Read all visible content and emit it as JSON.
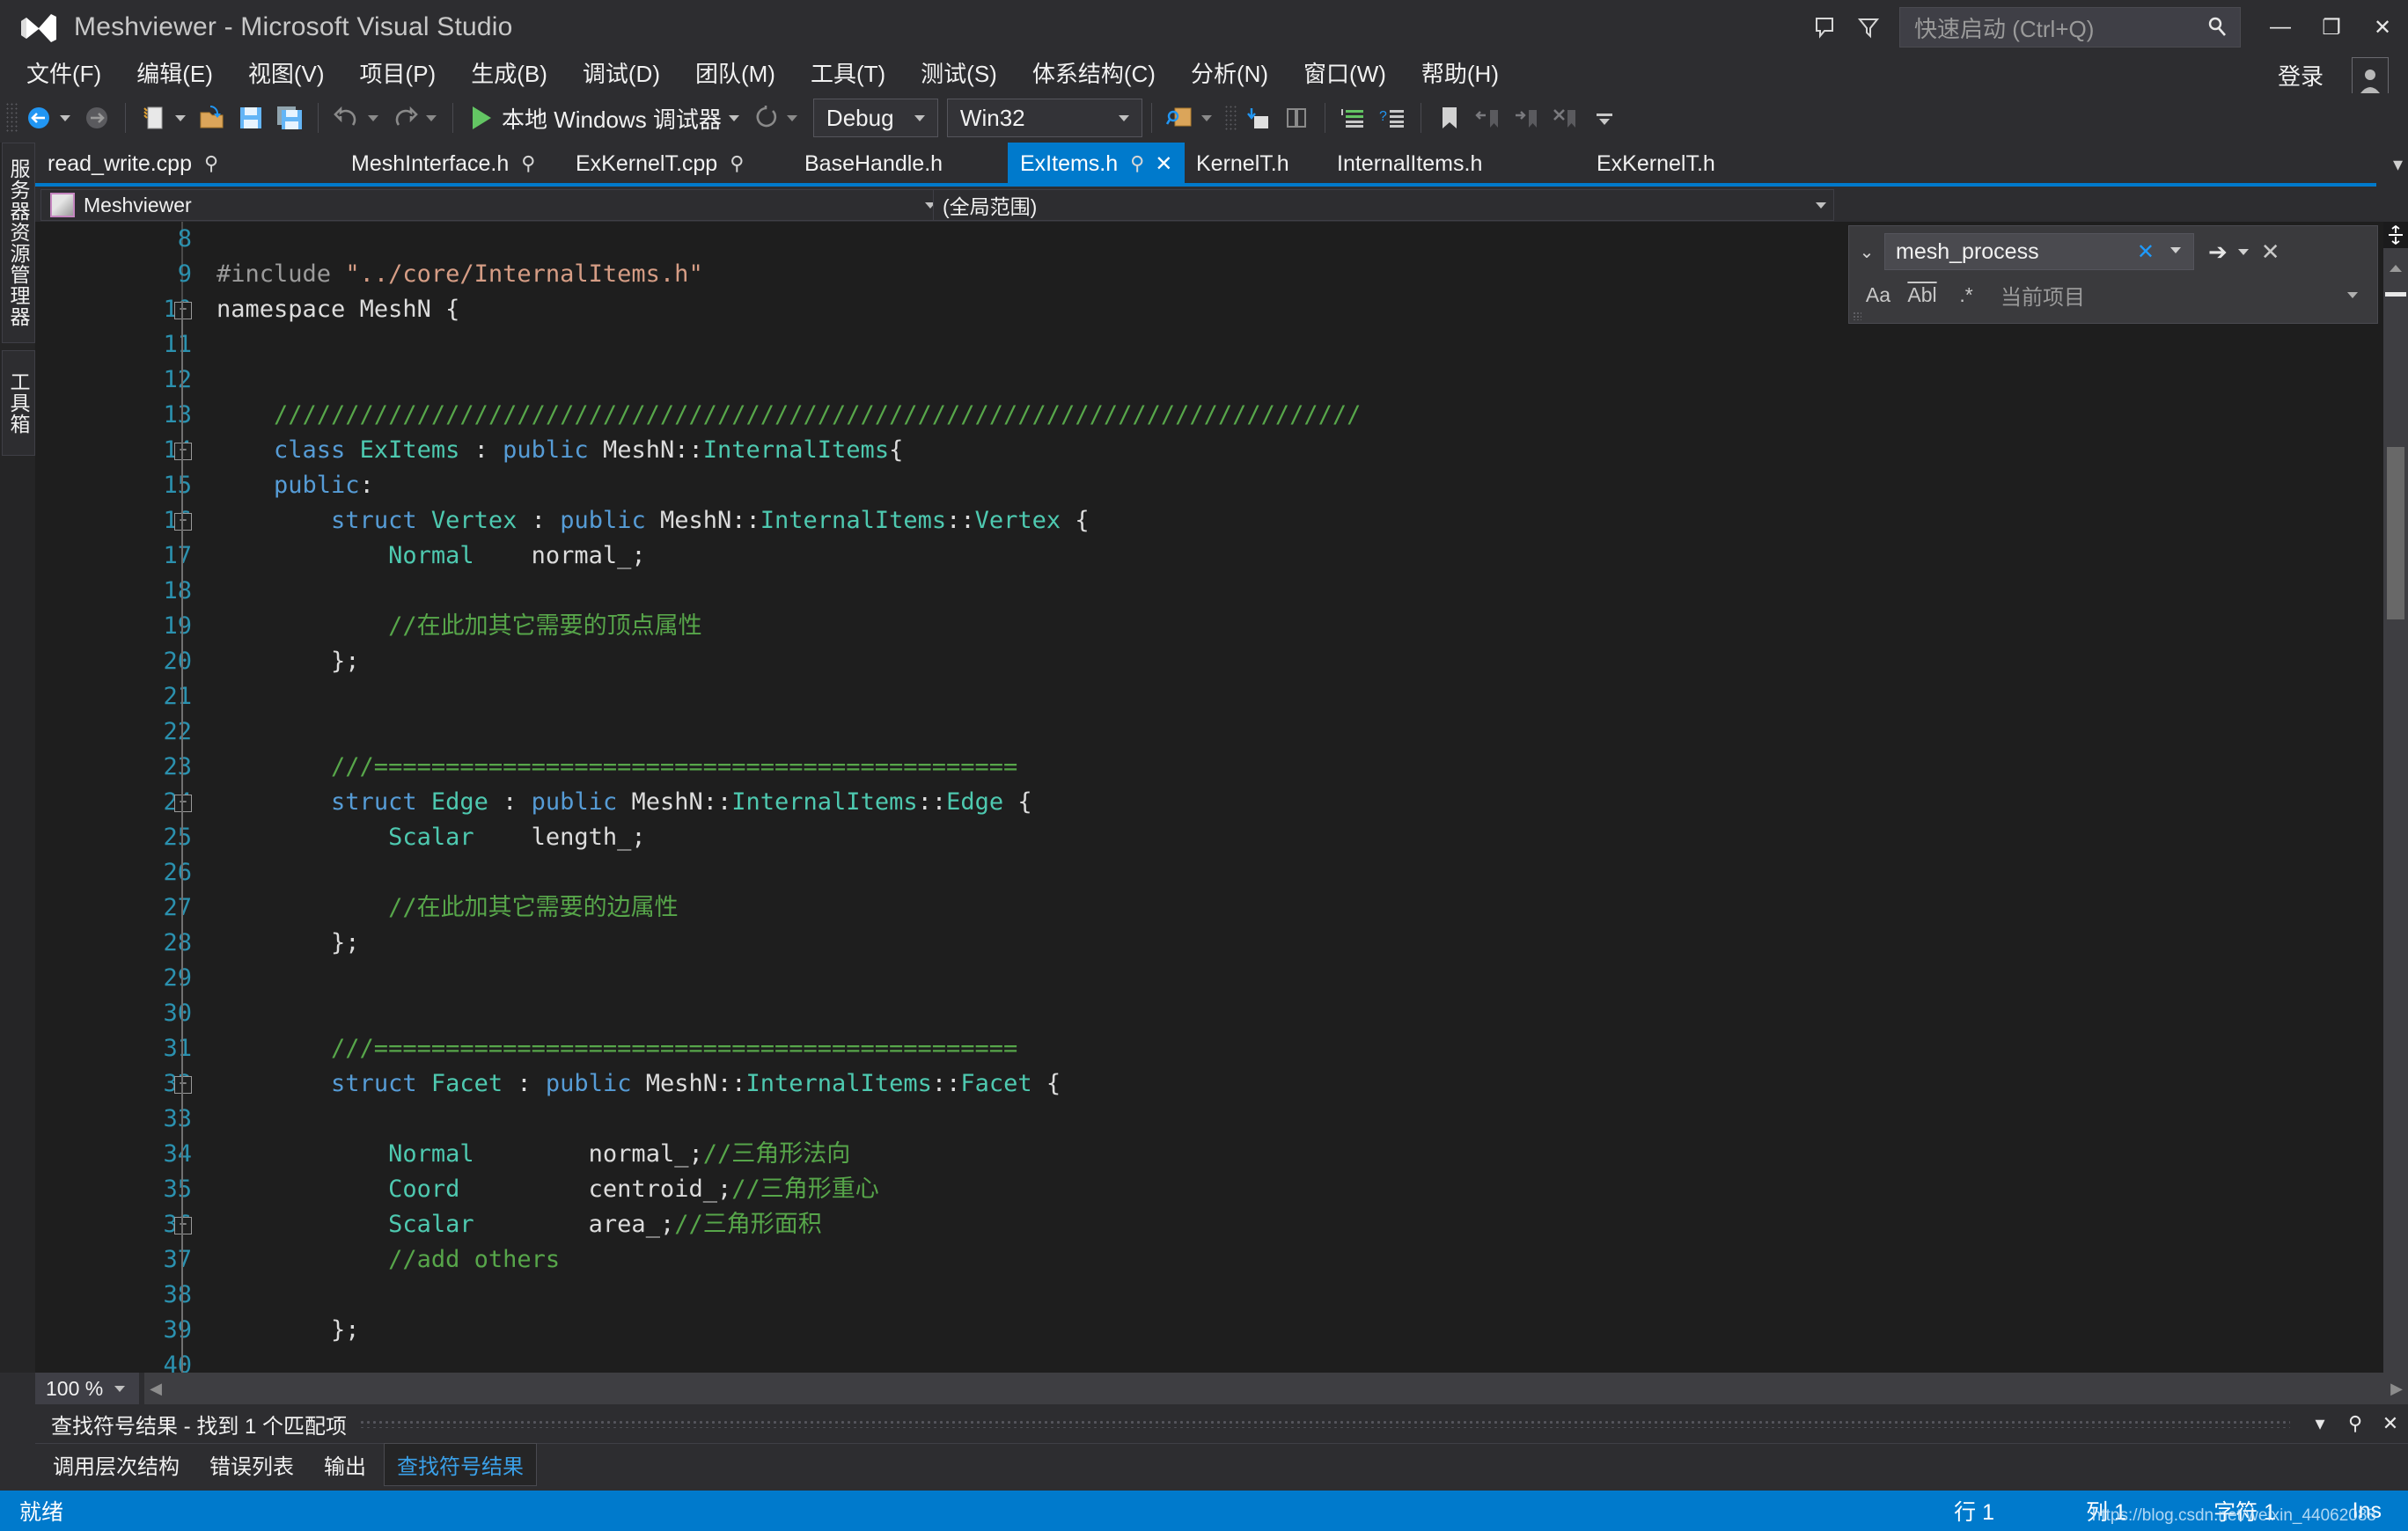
{
  "titlebar": {
    "title": "Meshviewer - Microsoft Visual Studio",
    "quick_launch_placeholder": "快速启动 (Ctrl+Q)",
    "feedback_icon": "feedback-icon",
    "filter_icon": "filter-icon",
    "search_icon": "search-icon",
    "minimize": "—",
    "restore": "❐",
    "close": "✕",
    "signin": "登录"
  },
  "menubar": {
    "items": [
      {
        "label": "文件(F)"
      },
      {
        "label": "编辑(E)"
      },
      {
        "label": "视图(V)"
      },
      {
        "label": "项目(P)"
      },
      {
        "label": "生成(B)"
      },
      {
        "label": "调试(D)"
      },
      {
        "label": "团队(M)"
      },
      {
        "label": "工具(T)"
      },
      {
        "label": "测试(S)"
      },
      {
        "label": "体系结构(C)"
      },
      {
        "label": "分析(N)"
      },
      {
        "label": "窗口(W)"
      },
      {
        "label": "帮助(H)"
      }
    ]
  },
  "toolbar": {
    "run_label": "本地 Windows 调试器",
    "config": "Debug",
    "platform": "Win32",
    "icons": {
      "nav_back": "navigate-back-icon",
      "nav_forward": "navigate-forward-icon",
      "new_project": "new-project-icon",
      "open_file": "open-file-icon",
      "save": "save-icon",
      "save_all": "save-all-icon",
      "undo": "undo-icon",
      "redo": "redo-icon",
      "restart": "restart-icon",
      "find_in_files": "find-in-files-icon",
      "step_into": "step-into-icon",
      "step_over": "step-over-icon",
      "comment": "comment-lines-icon",
      "uncomment": "uncomment-lines-icon",
      "bookmark": "bookmark-icon",
      "prev_bookmark": "previous-bookmark-icon",
      "next_bookmark": "next-bookmark-icon",
      "clear_bookmarks": "clear-bookmarks-icon",
      "overflow": "toolbar-overflow-icon"
    }
  },
  "leftdock": {
    "tabs": [
      {
        "label": "服务器资源管理器"
      },
      {
        "label": "工具箱"
      }
    ]
  },
  "tabs": [
    {
      "label": "read_write.cpp",
      "pinned": true,
      "active": false
    },
    {
      "label": "MeshInterface.h",
      "pinned": true,
      "active": false
    },
    {
      "label": "ExKernelT.cpp",
      "pinned": true,
      "active": false
    },
    {
      "label": "BaseHandle.h",
      "pinned": false,
      "active": false
    },
    {
      "label": "ExItems.h",
      "pinned": true,
      "active": true
    },
    {
      "label": "KernelT.h",
      "pinned": false,
      "active": false
    },
    {
      "label": "InternalItems.h",
      "pinned": false,
      "active": false
    },
    {
      "label": "ExKernelT.h",
      "pinned": false,
      "active": false
    }
  ],
  "navbar": {
    "project": "Meshviewer",
    "scope": "(全局范围)"
  },
  "find": {
    "query": "mesh_process",
    "scope": "当前项目",
    "match_case": "Aa",
    "match_word": "Abl",
    "regex": ".*",
    "clear": "✕",
    "find_next": "➔",
    "close": "✕"
  },
  "editor": {
    "first_line": 8,
    "zoom": "100 %",
    "lines": [
      {
        "n": 8,
        "fold": "",
        "tokens": []
      },
      {
        "n": 9,
        "fold": "",
        "tokens": [
          {
            "t": "#include ",
            "c": "pp"
          },
          {
            "t": "\"../core/InternalItems.h\"",
            "c": "str"
          }
        ]
      },
      {
        "n": 10,
        "fold": "minus",
        "tokens": [
          {
            "t": "namespace",
            "c": "txt"
          },
          {
            "t": " MeshN {",
            "c": "txt"
          }
        ]
      },
      {
        "n": 11,
        "fold": "",
        "tokens": []
      },
      {
        "n": 12,
        "fold": "",
        "tokens": []
      },
      {
        "n": 13,
        "fold": "",
        "tokens": [
          {
            "t": "    ////////////////////////////////////////////////////////////////////////////",
            "c": "cmt"
          }
        ]
      },
      {
        "n": 14,
        "fold": "minus",
        "tokens": [
          {
            "t": "    ",
            "c": "txt"
          },
          {
            "t": "class",
            "c": "kw"
          },
          {
            "t": " ",
            "c": "txt"
          },
          {
            "t": "ExItems",
            "c": "type"
          },
          {
            "t": " : ",
            "c": "txt"
          },
          {
            "t": "public",
            "c": "kw"
          },
          {
            "t": " MeshN::",
            "c": "txt"
          },
          {
            "t": "InternalItems",
            "c": "type"
          },
          {
            "t": "{",
            "c": "txt"
          }
        ]
      },
      {
        "n": 15,
        "fold": "",
        "tokens": [
          {
            "t": "    ",
            "c": "txt"
          },
          {
            "t": "public",
            "c": "kw"
          },
          {
            "t": ":",
            "c": "txt"
          }
        ]
      },
      {
        "n": 16,
        "fold": "minus",
        "tokens": [
          {
            "t": "        ",
            "c": "txt"
          },
          {
            "t": "struct",
            "c": "kw"
          },
          {
            "t": " ",
            "c": "txt"
          },
          {
            "t": "Vertex",
            "c": "type"
          },
          {
            "t": " : ",
            "c": "txt"
          },
          {
            "t": "public",
            "c": "kw"
          },
          {
            "t": " MeshN::",
            "c": "txt"
          },
          {
            "t": "InternalItems",
            "c": "type"
          },
          {
            "t": "::",
            "c": "txt"
          },
          {
            "t": "Vertex",
            "c": "type"
          },
          {
            "t": " {",
            "c": "txt"
          }
        ]
      },
      {
        "n": 17,
        "fold": "",
        "tokens": [
          {
            "t": "            ",
            "c": "txt"
          },
          {
            "t": "Normal",
            "c": "type"
          },
          {
            "t": "    normal_;",
            "c": "txt"
          }
        ]
      },
      {
        "n": 18,
        "fold": "",
        "tokens": []
      },
      {
        "n": 19,
        "fold": "",
        "tokens": [
          {
            "t": "            //在此加其它需要的顶点属性",
            "c": "cmt"
          }
        ]
      },
      {
        "n": 20,
        "fold": "",
        "tokens": [
          {
            "t": "        };",
            "c": "txt"
          }
        ]
      },
      {
        "n": 21,
        "fold": "",
        "tokens": []
      },
      {
        "n": 22,
        "fold": "",
        "tokens": []
      },
      {
        "n": 23,
        "fold": "",
        "tokens": [
          {
            "t": "        ///=============================================",
            "c": "cmt"
          }
        ]
      },
      {
        "n": 24,
        "fold": "minus",
        "tokens": [
          {
            "t": "        ",
            "c": "txt"
          },
          {
            "t": "struct",
            "c": "kw"
          },
          {
            "t": " ",
            "c": "txt"
          },
          {
            "t": "Edge",
            "c": "type"
          },
          {
            "t": " : ",
            "c": "txt"
          },
          {
            "t": "public",
            "c": "kw"
          },
          {
            "t": " MeshN::",
            "c": "txt"
          },
          {
            "t": "InternalItems",
            "c": "type"
          },
          {
            "t": "::",
            "c": "txt"
          },
          {
            "t": "Edge",
            "c": "type"
          },
          {
            "t": " {",
            "c": "txt"
          }
        ]
      },
      {
        "n": 25,
        "fold": "",
        "tokens": [
          {
            "t": "            ",
            "c": "txt"
          },
          {
            "t": "Scalar",
            "c": "type"
          },
          {
            "t": "    length_;",
            "c": "txt"
          }
        ]
      },
      {
        "n": 26,
        "fold": "",
        "tokens": []
      },
      {
        "n": 27,
        "fold": "",
        "tokens": [
          {
            "t": "            //在此加其它需要的边属性",
            "c": "cmt"
          }
        ]
      },
      {
        "n": 28,
        "fold": "",
        "tokens": [
          {
            "t": "        };",
            "c": "txt"
          }
        ]
      },
      {
        "n": 29,
        "fold": "",
        "tokens": []
      },
      {
        "n": 30,
        "fold": "",
        "tokens": []
      },
      {
        "n": 31,
        "fold": "",
        "tokens": [
          {
            "t": "        ///=============================================",
            "c": "cmt"
          }
        ]
      },
      {
        "n": 32,
        "fold": "minus",
        "tokens": [
          {
            "t": "        ",
            "c": "txt"
          },
          {
            "t": "struct",
            "c": "kw"
          },
          {
            "t": " ",
            "c": "txt"
          },
          {
            "t": "Facet",
            "c": "type"
          },
          {
            "t": " : ",
            "c": "txt"
          },
          {
            "t": "public",
            "c": "kw"
          },
          {
            "t": " MeshN::",
            "c": "txt"
          },
          {
            "t": "InternalItems",
            "c": "type"
          },
          {
            "t": "::",
            "c": "txt"
          },
          {
            "t": "Facet",
            "c": "type"
          },
          {
            "t": " {",
            "c": "txt"
          }
        ]
      },
      {
        "n": 33,
        "fold": "",
        "tokens": []
      },
      {
        "n": 34,
        "fold": "",
        "tokens": [
          {
            "t": "            ",
            "c": "txt"
          },
          {
            "t": "Normal",
            "c": "type"
          },
          {
            "t": "        normal_;",
            "c": "txt"
          },
          {
            "t": "//三角形法向",
            "c": "cmt"
          }
        ]
      },
      {
        "n": 35,
        "fold": "",
        "tokens": [
          {
            "t": "            ",
            "c": "txt"
          },
          {
            "t": "Coord",
            "c": "type"
          },
          {
            "t": "         centroid_;",
            "c": "txt"
          },
          {
            "t": "//三角形重心",
            "c": "cmt"
          }
        ]
      },
      {
        "n": 36,
        "fold": "minus",
        "tokens": [
          {
            "t": "            ",
            "c": "txt"
          },
          {
            "t": "Scalar",
            "c": "type"
          },
          {
            "t": "        area_;",
            "c": "txt"
          },
          {
            "t": "//三角形面积",
            "c": "cmt"
          }
        ]
      },
      {
        "n": 37,
        "fold": "",
        "tokens": [
          {
            "t": "            //add others",
            "c": "cmt"
          }
        ]
      },
      {
        "n": 38,
        "fold": "",
        "tokens": []
      },
      {
        "n": 39,
        "fold": "",
        "tokens": [
          {
            "t": "        };",
            "c": "txt"
          }
        ]
      },
      {
        "n": 40,
        "fold": "",
        "tokens": []
      }
    ]
  },
  "panel": {
    "title": "查找符号结果 - 找到 1 个匹配项",
    "dropdown_icon": "chevron-down-icon",
    "pin_icon": "pin-icon",
    "close_icon": "close-icon",
    "tabs": [
      {
        "label": "调用层次结构",
        "active": false
      },
      {
        "label": "错误列表",
        "active": false
      },
      {
        "label": "输出",
        "active": false
      },
      {
        "label": "查找符号结果",
        "active": true
      }
    ]
  },
  "statusbar": {
    "ready": "就绪",
    "line": "行 1",
    "column": "列 1",
    "character": "字符 1",
    "insert": "Ins",
    "watermark": "https://blog.csdn.net/weixin_44062088"
  },
  "colors": {
    "accent": "#007acc",
    "chrome": "#2d2d30",
    "editor_bg": "#1e1e1e",
    "keyword": "#569cd6",
    "type": "#4ec9b0",
    "comment": "#57a64a",
    "string": "#d69d85",
    "linenumber": "#2b91af",
    "run_green": "#63c563"
  }
}
